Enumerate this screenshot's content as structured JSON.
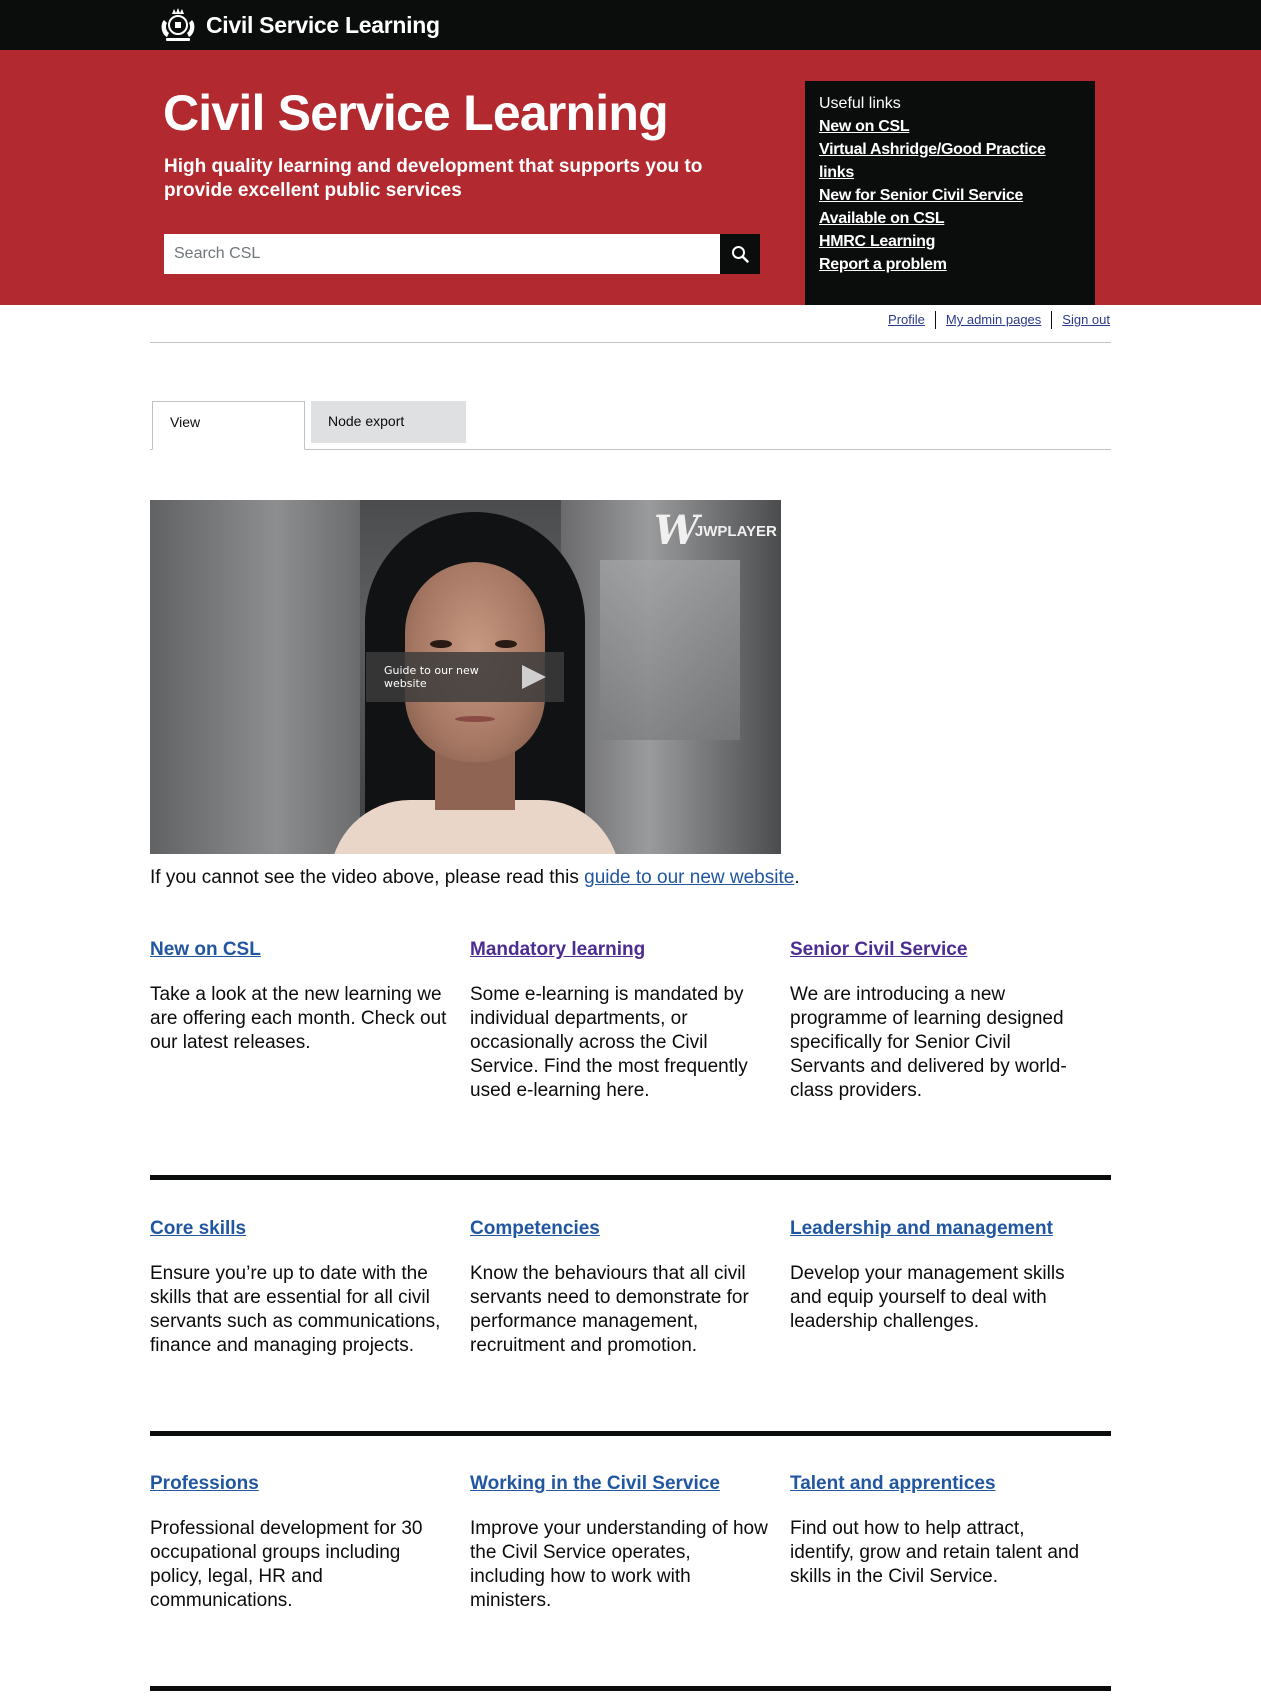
{
  "header": {
    "brand": "Civil Service Learning",
    "title": "Civil Service Learning",
    "subtitle": "High quality learning and development that supports you to provide excellent public services",
    "search_placeholder": "Search CSL"
  },
  "useful_links": {
    "title": "Useful links",
    "items": [
      "New on CSL",
      "Virtual Ashridge/Good Practice links",
      "New for Senior Civil Service",
      "Available on CSL",
      "HMRC Learning",
      "Report a problem"
    ]
  },
  "account": {
    "profile": "Profile",
    "admin": "My admin pages",
    "signout": "Sign out"
  },
  "tabs": {
    "view": "View",
    "export": "Node export"
  },
  "video": {
    "player_brand": "JWPLAYER",
    "play_label": "Guide to our new website"
  },
  "caption": {
    "prefix": "If you cannot see the video above, please read this ",
    "link": "guide to our new website",
    "suffix": "."
  },
  "cards": [
    {
      "title": "New on CSL",
      "text": "Take a look at the new learning we are offering each month. Check out our latest releases."
    },
    {
      "title": "Mandatory learning",
      "text": "Some e-learning is mandated by individual departments, or occasionally across the Civil Service. Find the most frequently used e-learning here."
    },
    {
      "title": "Senior Civil Service",
      "text": "We are introducing a new programme of learning designed specifically for Senior Civil Servants and delivered by world-class providers."
    },
    {
      "title": "Core skills",
      "text": "Ensure you’re up to date with the skills that are essential for all civil servants such as communications, finance and managing projects."
    },
    {
      "title": "Competencies",
      "text": "Know the behaviours that all civil servants need to demonstrate for performance management, recruitment and promotion."
    },
    {
      "title": "Leadership and management",
      "text": "Develop your management skills and equip yourself to deal with leadership challenges."
    },
    {
      "title": "Professions",
      "text": "Professional development for 30 occupational groups including policy, legal, HR and communications."
    },
    {
      "title": "Working in the Civil Service",
      "text": "Improve your understanding of how the Civil Service operates, including how to work with ministers."
    },
    {
      "title": "Talent and apprentices",
      "text": "Find out how to help attract, identify, grow and retain talent and skills in the Civil Service."
    }
  ],
  "colors": {
    "hero_red": "#b22a30",
    "black": "#0b0c0c",
    "link_blue": "#2156a0",
    "visited_purple": "#4c2c92"
  }
}
